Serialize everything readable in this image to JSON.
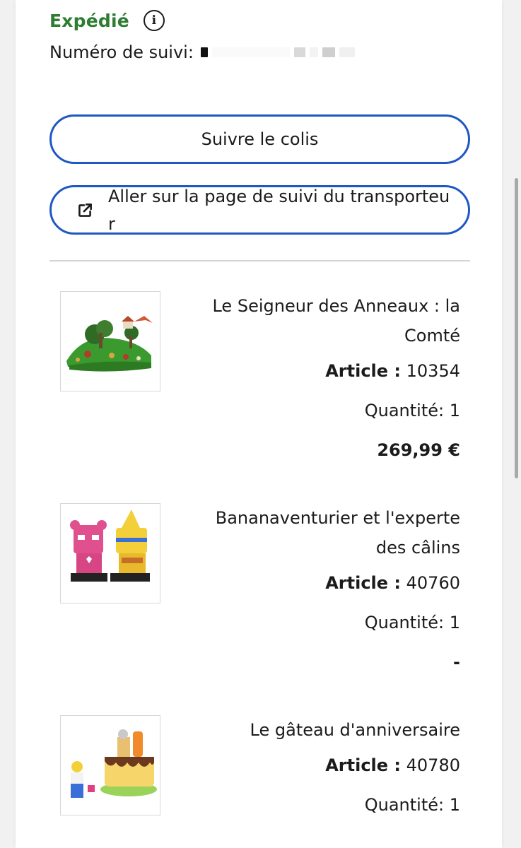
{
  "shipment": {
    "status": "Expédié",
    "status_color": "#2e7d32",
    "tracking_label": "Numéro de suivi:"
  },
  "buttons": {
    "track_parcel": "Suivre le colis",
    "carrier_page": "Aller sur la page de suivi du transporteur"
  },
  "icons": {
    "status_info": "info-icon",
    "carrier_link": "external-link-icon"
  },
  "products": [
    {
      "title": "Le Seigneur des Anneaux : la Comté",
      "article_label": "Article :",
      "article_number": "10354",
      "quantity": "Quantité: 1",
      "price": "269,99 €"
    },
    {
      "title": "Bananaventurier et l'experte des câlins",
      "article_label": "Article :",
      "article_number": "40760",
      "quantity": "Quantité: 1",
      "price": "-"
    },
    {
      "title": "Le gâteau d'anniversaire",
      "article_label": "Article :",
      "article_number": "40780",
      "quantity": "Quantité: 1"
    }
  ],
  "colors": {
    "accent": "#1f57c3",
    "text": "#1b1b1b",
    "background": "#f1f1f2"
  }
}
